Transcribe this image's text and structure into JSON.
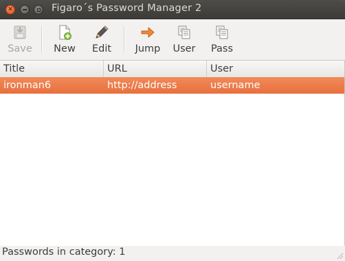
{
  "window": {
    "title": "Figaro´s Password Manager 2",
    "controls": [
      "close",
      "minimize",
      "maximize"
    ]
  },
  "toolbar": {
    "items": [
      {
        "label": "Save",
        "icon": "save-icon",
        "enabled": false
      },
      {
        "label": "New",
        "icon": "new-document-icon",
        "enabled": true
      },
      {
        "label": "Edit",
        "icon": "pencil-icon",
        "enabled": true
      },
      {
        "label": "Jump",
        "icon": "arrow-right-icon",
        "enabled": true
      },
      {
        "label": "User",
        "icon": "copy-icon",
        "enabled": true
      },
      {
        "label": "Pass",
        "icon": "copy-icon",
        "enabled": true
      }
    ]
  },
  "table": {
    "columns": [
      "Title",
      "URL",
      "User"
    ],
    "rows": [
      {
        "title": "ironman6",
        "url": "http://address",
        "user": "username",
        "selected": true
      }
    ]
  },
  "status": {
    "text": "Passwords in category: 1"
  },
  "colors": {
    "selection": "#e8703e",
    "titlebar": "#3c3b37",
    "close_button": "#e3541b"
  }
}
